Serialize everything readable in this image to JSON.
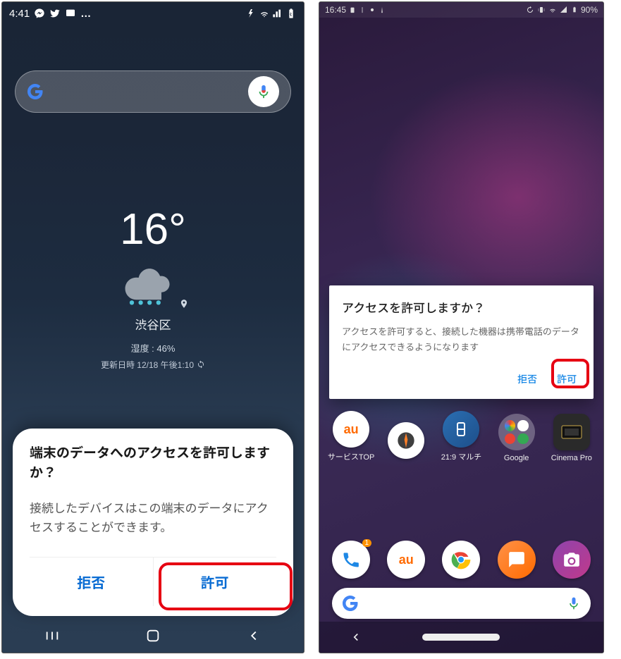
{
  "left": {
    "status": {
      "time": "4:41",
      "more": "…"
    },
    "weather": {
      "temp": "16°",
      "location": "渋谷区",
      "humidity": "湿度 : 46%",
      "updated": "更新日時 12/18 午後1:10"
    },
    "dialog": {
      "title": "端末のデータへのアクセスを許可しますか？",
      "message": "接続したデバイスはこの端末のデータにアクセスすることができます。",
      "deny": "拒否",
      "allow": "許可"
    }
  },
  "right": {
    "status": {
      "time": "16:45",
      "battery": "90%"
    },
    "dialog": {
      "title": "アクセスを許可しますか？",
      "message": "アクセスを許可すると、接続した機器は携帯電話のデータにアクセスできるようになります",
      "deny": "拒否",
      "allow": "許可"
    },
    "apps": {
      "row1": [
        {
          "label": "サービスTOP",
          "kind": "au"
        },
        {
          "label": "",
          "kind": "compass"
        },
        {
          "label": "21:9 マルチ",
          "kind": "multi"
        },
        {
          "label": "Google",
          "kind": "folder-google"
        },
        {
          "label": "Cinema Pro",
          "kind": "cinema"
        }
      ],
      "dock": [
        {
          "kind": "phone"
        },
        {
          "kind": "au2"
        },
        {
          "kind": "chrome"
        },
        {
          "kind": "message"
        },
        {
          "kind": "camera"
        }
      ]
    }
  }
}
